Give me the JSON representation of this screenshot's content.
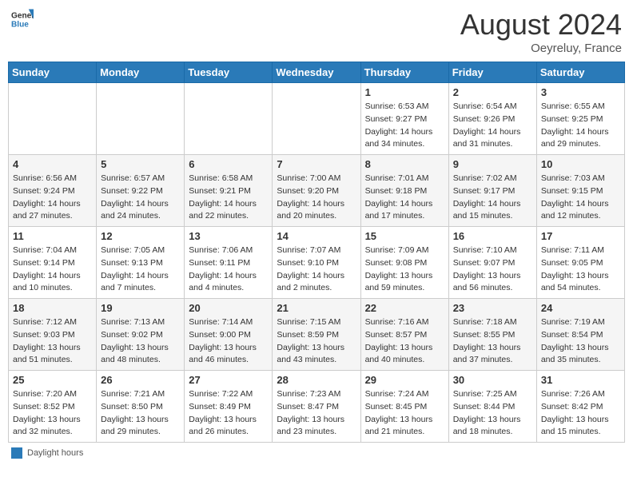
{
  "header": {
    "logo_general": "General",
    "logo_blue": "Blue",
    "month_year": "August 2024",
    "location": "Oeyreluy, France"
  },
  "legend": {
    "label": "Daylight hours"
  },
  "days_of_week": [
    "Sunday",
    "Monday",
    "Tuesday",
    "Wednesday",
    "Thursday",
    "Friday",
    "Saturday"
  ],
  "weeks": [
    [
      {
        "day": "",
        "info": ""
      },
      {
        "day": "",
        "info": ""
      },
      {
        "day": "",
        "info": ""
      },
      {
        "day": "",
        "info": ""
      },
      {
        "day": "1",
        "info": "Sunrise: 6:53 AM\nSunset: 9:27 PM\nDaylight: 14 hours\nand 34 minutes."
      },
      {
        "day": "2",
        "info": "Sunrise: 6:54 AM\nSunset: 9:26 PM\nDaylight: 14 hours\nand 31 minutes."
      },
      {
        "day": "3",
        "info": "Sunrise: 6:55 AM\nSunset: 9:25 PM\nDaylight: 14 hours\nand 29 minutes."
      }
    ],
    [
      {
        "day": "4",
        "info": "Sunrise: 6:56 AM\nSunset: 9:24 PM\nDaylight: 14 hours\nand 27 minutes."
      },
      {
        "day": "5",
        "info": "Sunrise: 6:57 AM\nSunset: 9:22 PM\nDaylight: 14 hours\nand 24 minutes."
      },
      {
        "day": "6",
        "info": "Sunrise: 6:58 AM\nSunset: 9:21 PM\nDaylight: 14 hours\nand 22 minutes."
      },
      {
        "day": "7",
        "info": "Sunrise: 7:00 AM\nSunset: 9:20 PM\nDaylight: 14 hours\nand 20 minutes."
      },
      {
        "day": "8",
        "info": "Sunrise: 7:01 AM\nSunset: 9:18 PM\nDaylight: 14 hours\nand 17 minutes."
      },
      {
        "day": "9",
        "info": "Sunrise: 7:02 AM\nSunset: 9:17 PM\nDaylight: 14 hours\nand 15 minutes."
      },
      {
        "day": "10",
        "info": "Sunrise: 7:03 AM\nSunset: 9:15 PM\nDaylight: 14 hours\nand 12 minutes."
      }
    ],
    [
      {
        "day": "11",
        "info": "Sunrise: 7:04 AM\nSunset: 9:14 PM\nDaylight: 14 hours\nand 10 minutes."
      },
      {
        "day": "12",
        "info": "Sunrise: 7:05 AM\nSunset: 9:13 PM\nDaylight: 14 hours\nand 7 minutes."
      },
      {
        "day": "13",
        "info": "Sunrise: 7:06 AM\nSunset: 9:11 PM\nDaylight: 14 hours\nand 4 minutes."
      },
      {
        "day": "14",
        "info": "Sunrise: 7:07 AM\nSunset: 9:10 PM\nDaylight: 14 hours\nand 2 minutes."
      },
      {
        "day": "15",
        "info": "Sunrise: 7:09 AM\nSunset: 9:08 PM\nDaylight: 13 hours\nand 59 minutes."
      },
      {
        "day": "16",
        "info": "Sunrise: 7:10 AM\nSunset: 9:07 PM\nDaylight: 13 hours\nand 56 minutes."
      },
      {
        "day": "17",
        "info": "Sunrise: 7:11 AM\nSunset: 9:05 PM\nDaylight: 13 hours\nand 54 minutes."
      }
    ],
    [
      {
        "day": "18",
        "info": "Sunrise: 7:12 AM\nSunset: 9:03 PM\nDaylight: 13 hours\nand 51 minutes."
      },
      {
        "day": "19",
        "info": "Sunrise: 7:13 AM\nSunset: 9:02 PM\nDaylight: 13 hours\nand 48 minutes."
      },
      {
        "day": "20",
        "info": "Sunrise: 7:14 AM\nSunset: 9:00 PM\nDaylight: 13 hours\nand 46 minutes."
      },
      {
        "day": "21",
        "info": "Sunrise: 7:15 AM\nSunset: 8:59 PM\nDaylight: 13 hours\nand 43 minutes."
      },
      {
        "day": "22",
        "info": "Sunrise: 7:16 AM\nSunset: 8:57 PM\nDaylight: 13 hours\nand 40 minutes."
      },
      {
        "day": "23",
        "info": "Sunrise: 7:18 AM\nSunset: 8:55 PM\nDaylight: 13 hours\nand 37 minutes."
      },
      {
        "day": "24",
        "info": "Sunrise: 7:19 AM\nSunset: 8:54 PM\nDaylight: 13 hours\nand 35 minutes."
      }
    ],
    [
      {
        "day": "25",
        "info": "Sunrise: 7:20 AM\nSunset: 8:52 PM\nDaylight: 13 hours\nand 32 minutes."
      },
      {
        "day": "26",
        "info": "Sunrise: 7:21 AM\nSunset: 8:50 PM\nDaylight: 13 hours\nand 29 minutes."
      },
      {
        "day": "27",
        "info": "Sunrise: 7:22 AM\nSunset: 8:49 PM\nDaylight: 13 hours\nand 26 minutes."
      },
      {
        "day": "28",
        "info": "Sunrise: 7:23 AM\nSunset: 8:47 PM\nDaylight: 13 hours\nand 23 minutes."
      },
      {
        "day": "29",
        "info": "Sunrise: 7:24 AM\nSunset: 8:45 PM\nDaylight: 13 hours\nand 21 minutes."
      },
      {
        "day": "30",
        "info": "Sunrise: 7:25 AM\nSunset: 8:44 PM\nDaylight: 13 hours\nand 18 minutes."
      },
      {
        "day": "31",
        "info": "Sunrise: 7:26 AM\nSunset: 8:42 PM\nDaylight: 13 hours\nand 15 minutes."
      }
    ]
  ]
}
